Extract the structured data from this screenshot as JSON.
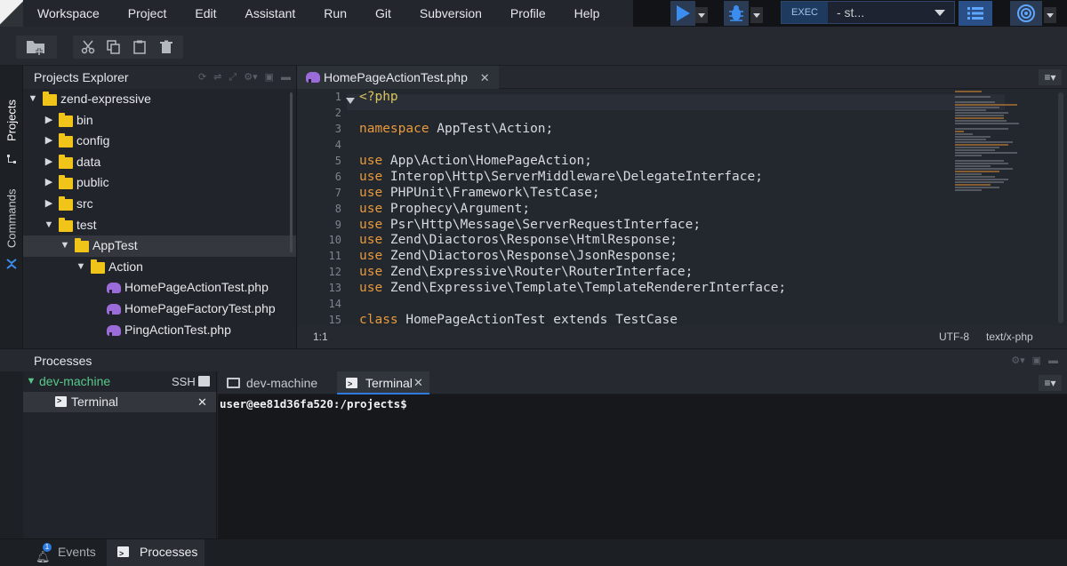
{
  "menubar": {
    "items": [
      "Workspace",
      "Project",
      "Edit",
      "Assistant",
      "Run",
      "Git",
      "Subversion",
      "Profile",
      "Help"
    ],
    "exec_label": "EXEC",
    "exec_value": "- st..."
  },
  "explorer": {
    "title": "Projects Explorer",
    "tree": [
      {
        "label": "zend-expressive",
        "depth": 0,
        "kind": "project",
        "open": true
      },
      {
        "label": "bin",
        "depth": 1,
        "kind": "folder",
        "open": false
      },
      {
        "label": "config",
        "depth": 1,
        "kind": "folder",
        "open": false
      },
      {
        "label": "data",
        "depth": 1,
        "kind": "folder",
        "open": false
      },
      {
        "label": "public",
        "depth": 1,
        "kind": "folder",
        "open": false
      },
      {
        "label": "src",
        "depth": 1,
        "kind": "folder",
        "open": false
      },
      {
        "label": "test",
        "depth": 1,
        "kind": "folder",
        "open": true
      },
      {
        "label": "AppTest",
        "depth": 2,
        "kind": "folder",
        "open": true,
        "selected": true
      },
      {
        "label": "Action",
        "depth": 3,
        "kind": "folder",
        "open": true
      },
      {
        "label": "HomePageActionTest.php",
        "depth": 4,
        "kind": "php"
      },
      {
        "label": "HomePageFactoryTest.php",
        "depth": 4,
        "kind": "php"
      },
      {
        "label": "PingActionTest.php",
        "depth": 4,
        "kind": "php"
      }
    ]
  },
  "sidebar": {
    "projects_tab": "Projects",
    "commands_tab": "Commands"
  },
  "editor": {
    "tab_label": "HomePageActionTest.php",
    "line_numbers": [
      "1",
      "2",
      "3",
      "4",
      "5",
      "6",
      "7",
      "8",
      "9",
      "10",
      "11",
      "12",
      "13",
      "14",
      "15"
    ],
    "lines": [
      {
        "kw": "",
        "tag": "<?php",
        "rest": ""
      },
      {
        "kw": "",
        "tag": "",
        "rest": ""
      },
      {
        "kw": "namespace",
        "tag": "",
        "rest": " AppTest\\Action;"
      },
      {
        "kw": "",
        "tag": "",
        "rest": ""
      },
      {
        "kw": "use",
        "tag": "",
        "rest": " App\\Action\\HomePageAction;"
      },
      {
        "kw": "use",
        "tag": "",
        "rest": " Interop\\Http\\ServerMiddleware\\DelegateInterface;"
      },
      {
        "kw": "use",
        "tag": "",
        "rest": " PHPUnit\\Framework\\TestCase;"
      },
      {
        "kw": "use",
        "tag": "",
        "rest": " Prophecy\\Argument;"
      },
      {
        "kw": "use",
        "tag": "",
        "rest": " Psr\\Http\\Message\\ServerRequestInterface;"
      },
      {
        "kw": "use",
        "tag": "",
        "rest": " Zend\\Diactoros\\Response\\HtmlResponse;"
      },
      {
        "kw": "use",
        "tag": "",
        "rest": " Zend\\Diactoros\\Response\\JsonResponse;"
      },
      {
        "kw": "use",
        "tag": "",
        "rest": " Zend\\Expressive\\Router\\RouterInterface;"
      },
      {
        "kw": "use",
        "tag": "",
        "rest": " Zend\\Expressive\\Template\\TemplateRendererInterface;"
      },
      {
        "kw": "",
        "tag": "",
        "rest": ""
      },
      {
        "kw": "class",
        "tag": "",
        "rest": " HomePageActionTest extends TestCase"
      }
    ],
    "status_position": "1:1",
    "status_encoding": "UTF-8",
    "status_type": "text/x-php"
  },
  "processes": {
    "title": "Processes",
    "machine": "dev-machine",
    "ssh_label": "SSH",
    "terminal_label": "Terminal",
    "tabs": [
      "dev-machine",
      "Terminal"
    ],
    "terminal_output": "user@ee81d36fa520:/projects$"
  },
  "bottombar": {
    "events_label": "Events",
    "processes_label": "Processes",
    "events_badge": "1"
  },
  "colors": {
    "accent_blue": "#2d7be0",
    "keyword": "#e89a3c",
    "folder": "#f0c419",
    "php": "#9b6bd9",
    "machine_green": "#58c88a"
  }
}
